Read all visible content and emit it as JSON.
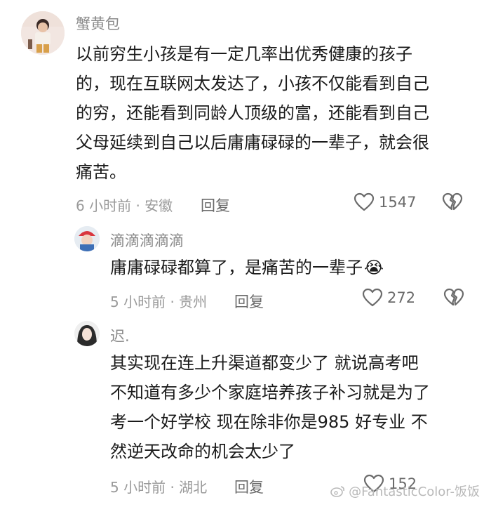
{
  "comments": [
    {
      "user": "蟹黄包",
      "text_lines": [
        "以前穷生小孩是有一定几率出优秀健康的孩子",
        "的，现在互联网太发达了，小孩不仅能看到自己",
        "的穷，还能看到同龄人顶级的富，还能看到自己",
        "父母延续到自己以后庸庸碌碌的一辈子，就会很",
        "痛苦。"
      ],
      "time_location": "6 小时前 · 安徽",
      "reply_label": "回复",
      "likes": "1547"
    },
    {
      "user": "滴滴滴滴滴",
      "text_lines": [
        "庸庸碌碌都算了，是痛苦的一辈子"
      ],
      "emoji": "😭",
      "time_location": "5 小时前 · 贵州",
      "reply_label": "回复",
      "likes": "272"
    },
    {
      "user": "迟.",
      "text_lines": [
        "其实现在连上升渠道都变少了 就说高考吧",
        "不知道有多少个家庭培养孩子补习就是为了",
        "考一个好学校 现在除非你是985 好专业 不",
        "然逆天改命的机会太少了"
      ],
      "time_location": "5 小时前 · 湖北",
      "reply_label": "回复",
      "likes": "152"
    }
  ],
  "watermark": "@FantasticColor-饭饭",
  "icons": {
    "like": "heart-outline-icon",
    "dislike": "broken-heart-icon",
    "watermark_logo": "weibo-logo-icon"
  }
}
